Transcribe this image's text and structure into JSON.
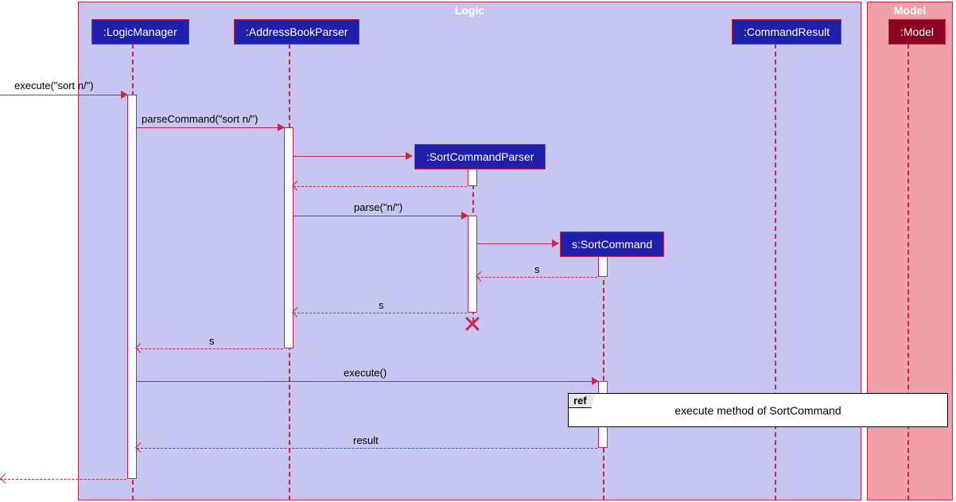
{
  "frames": {
    "logic_label": "Logic",
    "model_label": "Model"
  },
  "participants": {
    "logic_manager": ":LogicManager",
    "address_book_parser": ":AddressBookParser",
    "sort_command_parser": ":SortCommandParser",
    "sort_command": "s:SortCommand",
    "command_result": ":CommandResult",
    "model": ":Model"
  },
  "messages": {
    "execute_sort": "execute(\"sort n/\")",
    "parse_command": "parseCommand(\"sort n/\")",
    "parse_n": "parse(\"n/\")",
    "return_s1": "s",
    "return_s2": "s",
    "return_s3": "s",
    "execute_empty": "execute()",
    "return_result": "result"
  },
  "ref": {
    "tab": "ref",
    "text": "execute method of SortCommand"
  }
}
